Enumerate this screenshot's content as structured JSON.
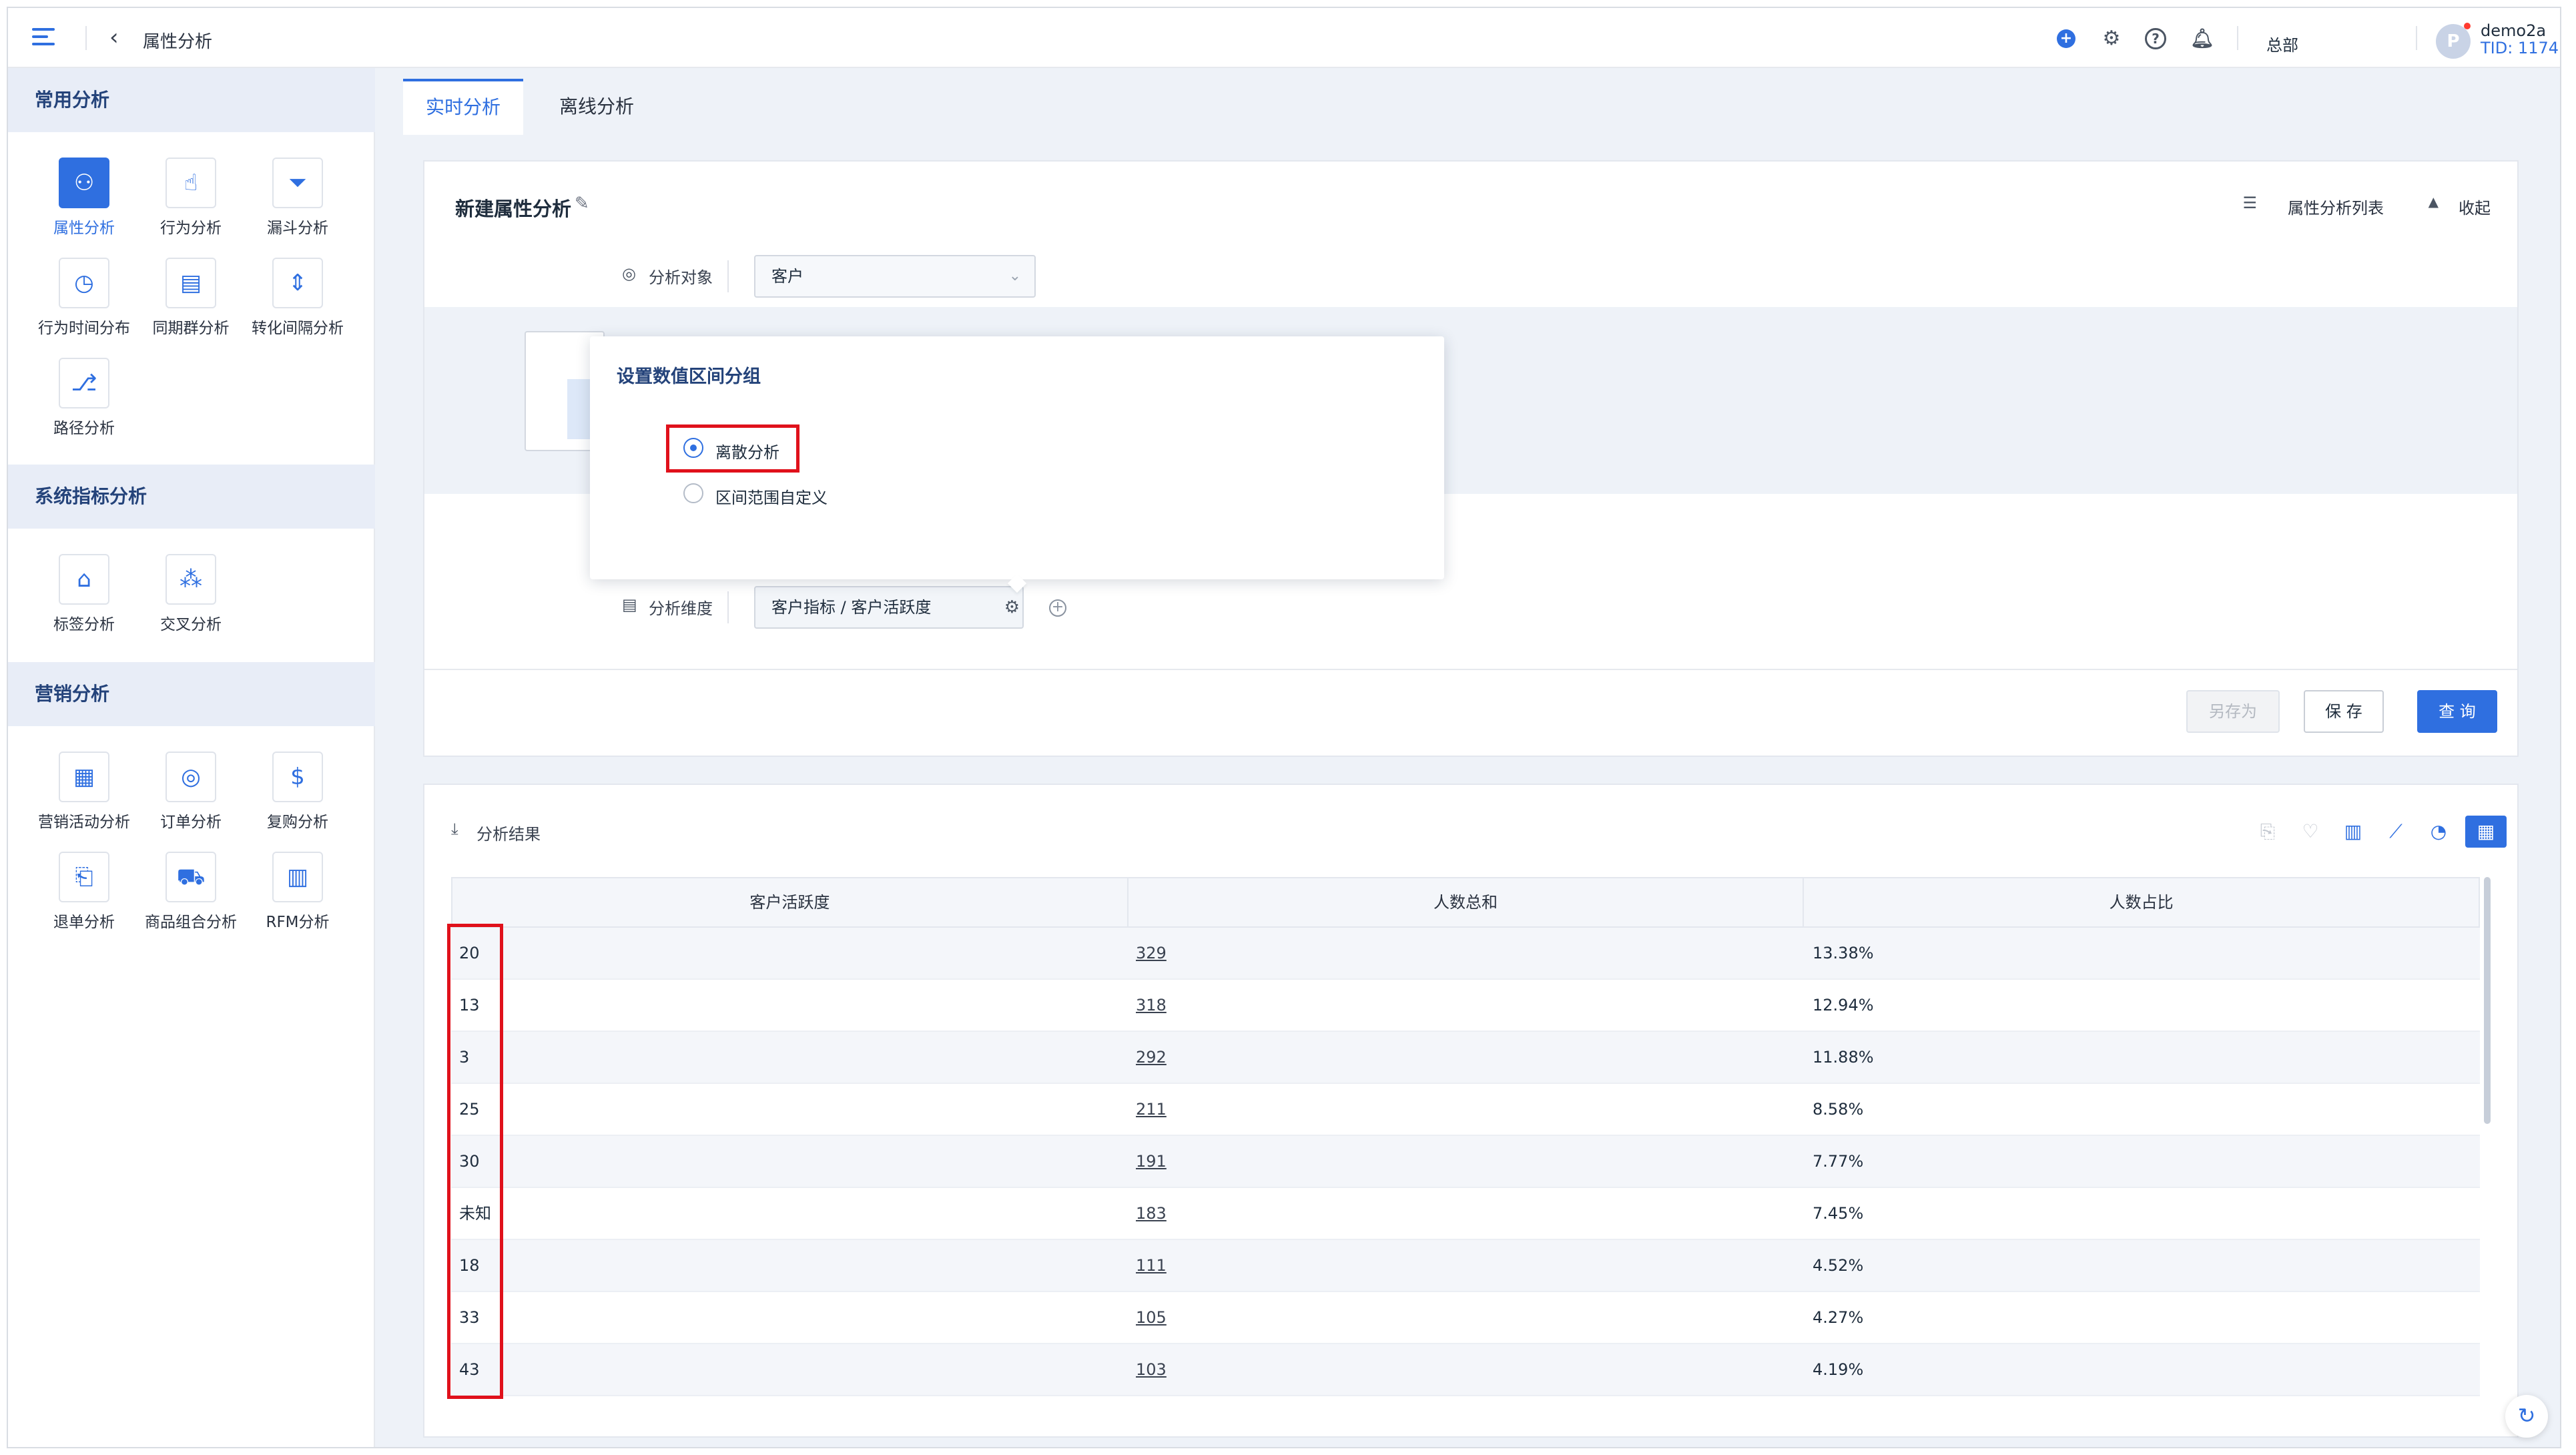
{
  "header": {
    "breadcrumb": "属性分析",
    "org": "总部",
    "user_name": "demo2a",
    "user_tid": "TID: 1174",
    "avatar_letter": "P"
  },
  "sidebar": {
    "sections": [
      {
        "title": "常用分析",
        "items": [
          {
            "label": "属性分析",
            "icon": "user-icon",
            "active": true
          },
          {
            "label": "行为分析",
            "icon": "behavior-icon"
          },
          {
            "label": "漏斗分析",
            "icon": "funnel-icon"
          },
          {
            "label": "行为时间分布",
            "icon": "clock-icon"
          },
          {
            "label": "同期群分析",
            "icon": "cohort-icon"
          },
          {
            "label": "转化间隔分析",
            "icon": "interval-icon"
          },
          {
            "label": "路径分析",
            "icon": "path-icon"
          }
        ]
      },
      {
        "title": "系统指标分析",
        "items": [
          {
            "label": "标签分析",
            "icon": "tag-icon"
          },
          {
            "label": "交叉分析",
            "icon": "cross-icon"
          }
        ]
      },
      {
        "title": "营销分析",
        "items": [
          {
            "label": "营销活动分析",
            "icon": "campaign-icon"
          },
          {
            "label": "订单分析",
            "icon": "order-icon"
          },
          {
            "label": "复购分析",
            "icon": "repurchase-icon"
          },
          {
            "label": "退单分析",
            "icon": "refund-icon"
          },
          {
            "label": "商品组合分析",
            "icon": "bundle-icon"
          },
          {
            "label": "RFM分析",
            "icon": "rfm-icon"
          }
        ]
      }
    ]
  },
  "tabs": [
    {
      "label": "实时分析",
      "active": true
    },
    {
      "label": "离线分析",
      "active": false
    }
  ],
  "config": {
    "title": "新建属性分析",
    "list_link": "属性分析列表",
    "collapse": "收起",
    "object_label": "分析对象",
    "object_value": "客户",
    "dimension_label": "分析维度",
    "dimension_value": "客户指标 / 客户活跃度",
    "buttons": {
      "save_as": "另存为",
      "save": "保 存",
      "query": "查 询"
    }
  },
  "popover": {
    "title": "设置数值区间分组",
    "options": [
      {
        "label": "离散分析",
        "checked": true
      },
      {
        "label": "区间范围自定义",
        "checked": false
      }
    ]
  },
  "results": {
    "title": "分析结果",
    "columns": [
      "客户活跃度",
      "人数总和",
      "人数占比"
    ],
    "rows": [
      [
        "20",
        "329",
        "13.38%"
      ],
      [
        "13",
        "318",
        "12.94%"
      ],
      [
        "3",
        "292",
        "11.88%"
      ],
      [
        "25",
        "211",
        "8.58%"
      ],
      [
        "30",
        "191",
        "7.77%"
      ],
      [
        "未知",
        "183",
        "7.45%"
      ],
      [
        "18",
        "111",
        "4.52%"
      ],
      [
        "33",
        "105",
        "4.27%"
      ],
      [
        "43",
        "103",
        "4.19%"
      ]
    ]
  },
  "colors": {
    "accent": "#2f6fe0",
    "highlight_box": "#e0111b"
  }
}
